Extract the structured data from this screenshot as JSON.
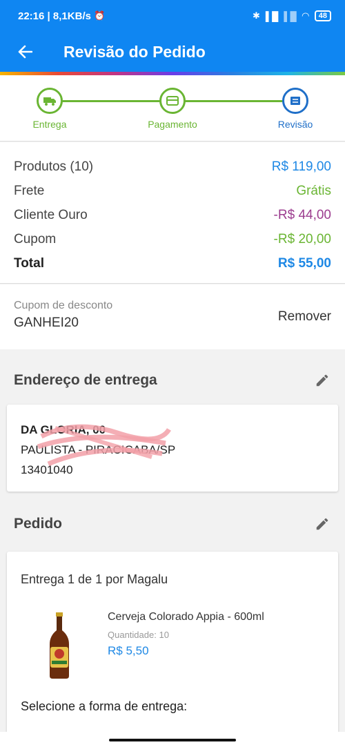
{
  "statusbar": {
    "time": "22:16",
    "network": "8,1KB/s",
    "battery": "48"
  },
  "header": {
    "title": "Revisão do Pedido"
  },
  "steps": [
    {
      "label": "Entrega"
    },
    {
      "label": "Pagamento"
    },
    {
      "label": "Revisão"
    }
  ],
  "summary": {
    "rows": [
      {
        "label": "Produtos (10)",
        "value": "R$ 119,00",
        "color": "#1e88e5"
      },
      {
        "label": "Frete",
        "value": "Grátis",
        "color": "#6ab533"
      },
      {
        "label": "Cliente Ouro",
        "value": "-R$ 44,00",
        "color": "#9c3d8f"
      },
      {
        "label": "Cupom",
        "value": "-R$ 20,00",
        "color": "#6ab533"
      }
    ],
    "total_label": "Total",
    "total_value": "R$ 55,00",
    "total_color": "#1e88e5"
  },
  "coupon": {
    "label": "Cupom de desconto",
    "code": "GANHEI20",
    "remove_label": "Remover"
  },
  "address_section": {
    "title": "Endereço de entrega",
    "line1": "DA GLORIA, 00",
    "line2": "PAULISTA - PIRACICABA/SP",
    "line3": "13401040"
  },
  "order_section": {
    "title": "Pedido",
    "delivery_title": "Entrega 1 de 1 por Magalu",
    "product_name": "Cerveja Colorado Appia - 600ml",
    "quantity_label": "Quantidade:",
    "quantity_value": "10",
    "price": "R$ 5,50",
    "delivery_method_label": "Selecione a forma de entrega:"
  }
}
